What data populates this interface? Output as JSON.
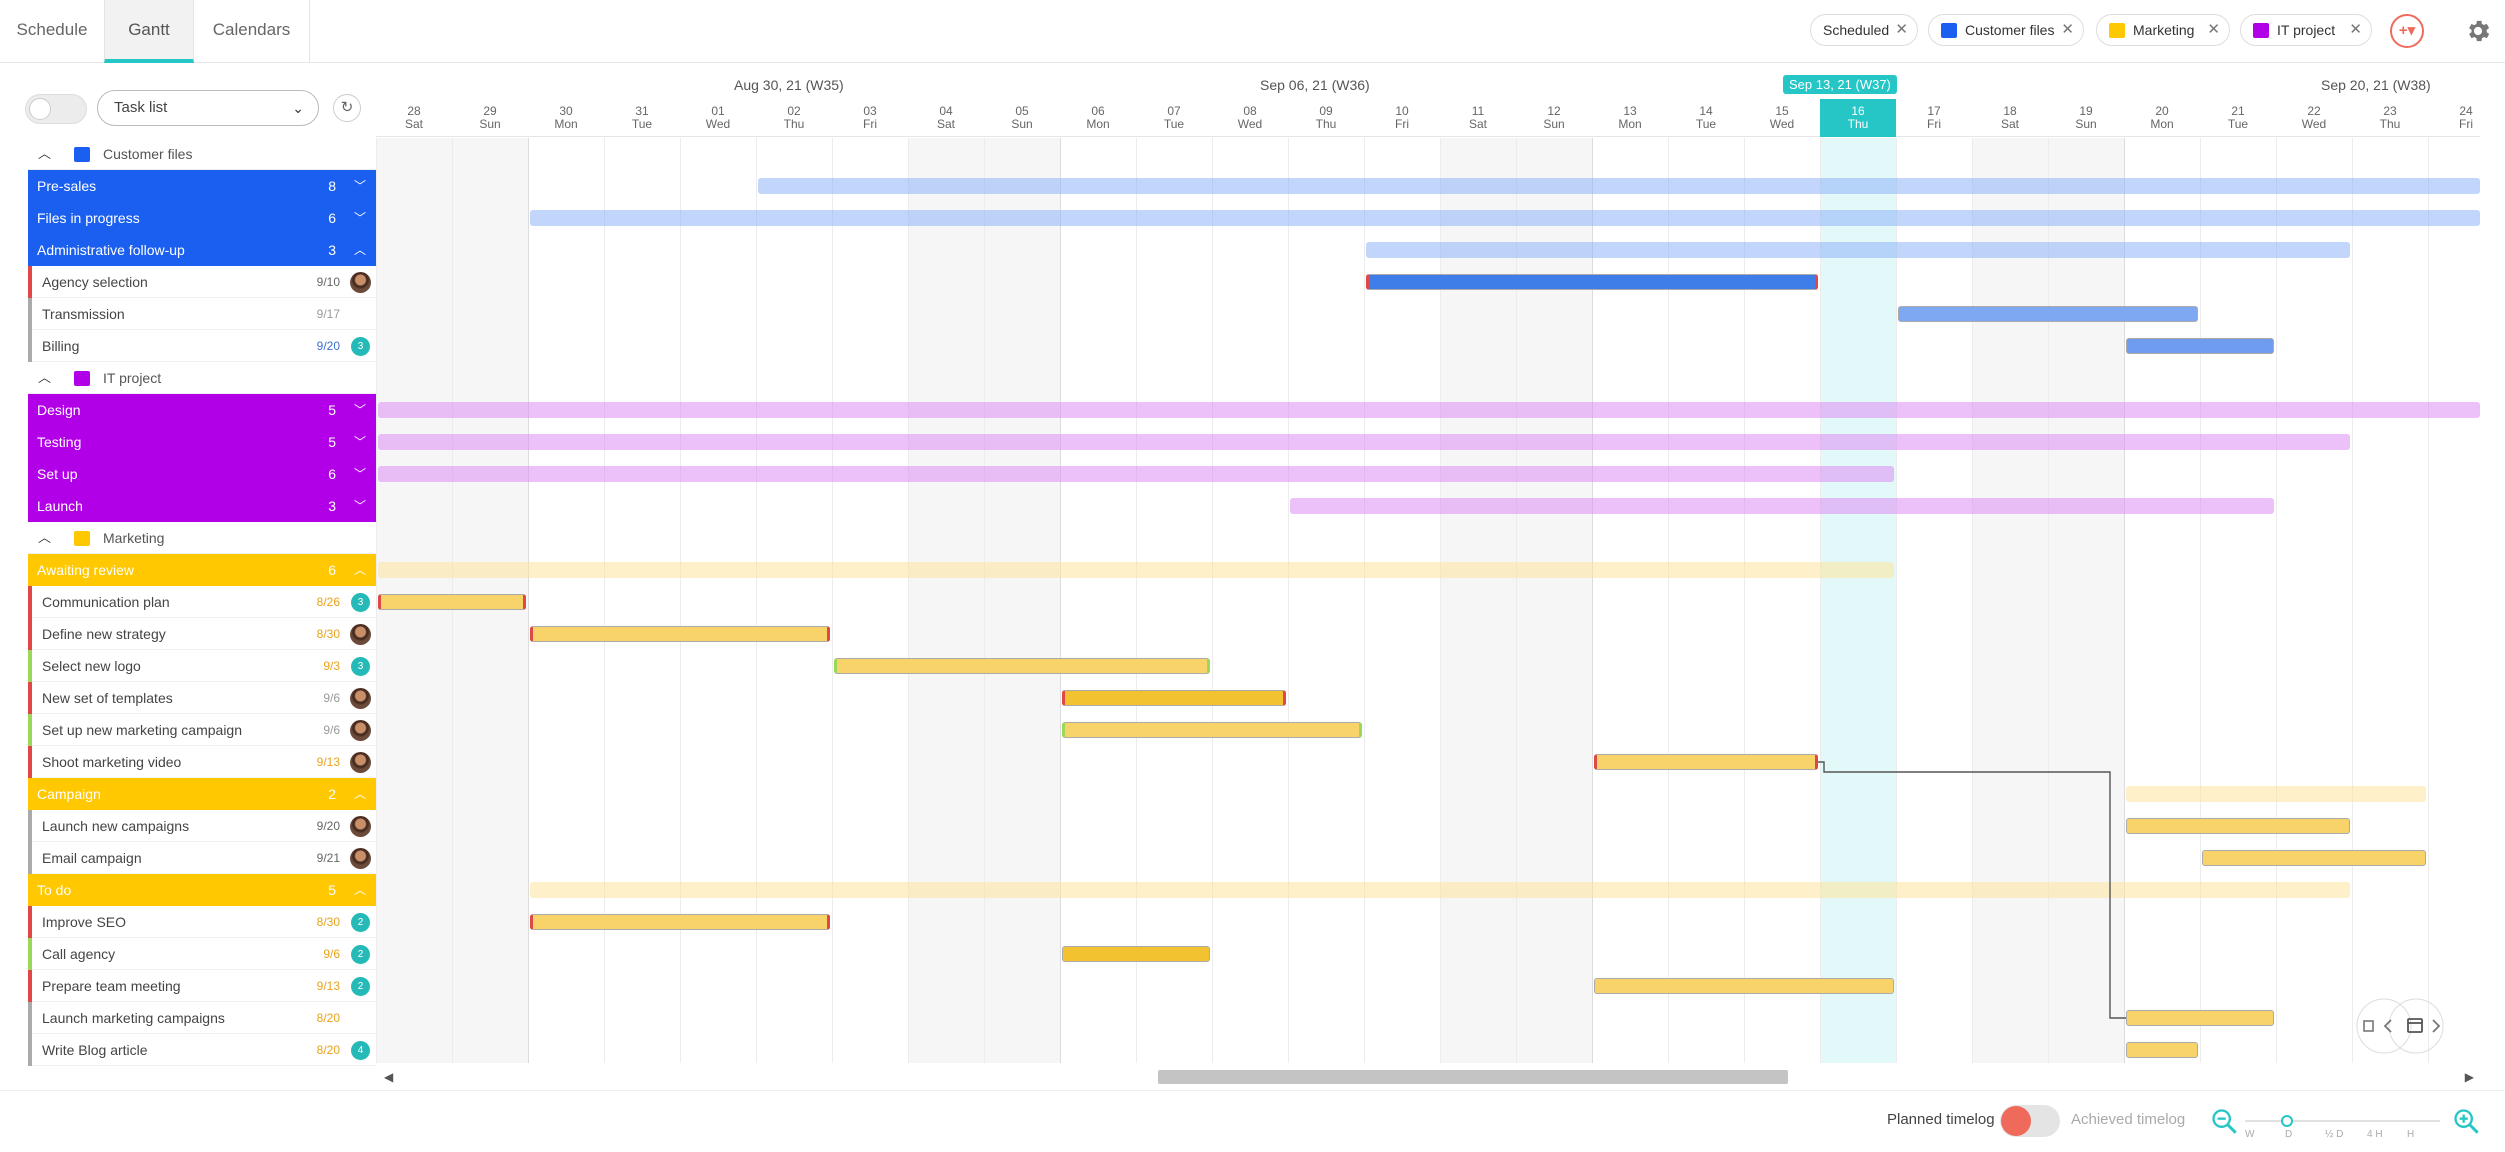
{
  "tabs": [
    {
      "label": "Schedule"
    },
    {
      "label": "Gantt"
    },
    {
      "label": "Calendars"
    }
  ],
  "filters": [
    {
      "label": "Scheduled",
      "color": ""
    },
    {
      "label": "Customer files",
      "color": "#1a5ff0"
    },
    {
      "label": "Marketing",
      "color": "#ffc800"
    },
    {
      "label": "IT project",
      "color": "#b100e8"
    }
  ],
  "filter_button": "+",
  "view_select": {
    "value": "Task list"
  },
  "timeline": {
    "weeks": [
      {
        "label": "Aug 30, 21 (W35)",
        "today": false
      },
      {
        "label": "Sep 06, 21 (W36)",
        "today": false
      },
      {
        "label": "Sep 13, 21 (W37)",
        "today": true
      },
      {
        "label": "Sep 20, 21 (W38)",
        "today": false
      }
    ],
    "days": [
      {
        "n": "28",
        "d": "Sat"
      },
      {
        "n": "29",
        "d": "Sun"
      },
      {
        "n": "30",
        "d": "Mon"
      },
      {
        "n": "31",
        "d": "Tue"
      },
      {
        "n": "01",
        "d": "Wed"
      },
      {
        "n": "02",
        "d": "Thu"
      },
      {
        "n": "03",
        "d": "Fri"
      },
      {
        "n": "04",
        "d": "Sat"
      },
      {
        "n": "05",
        "d": "Sun"
      },
      {
        "n": "06",
        "d": "Mon"
      },
      {
        "n": "07",
        "d": "Tue"
      },
      {
        "n": "08",
        "d": "Wed"
      },
      {
        "n": "09",
        "d": "Thu"
      },
      {
        "n": "10",
        "d": "Fri"
      },
      {
        "n": "11",
        "d": "Sat"
      },
      {
        "n": "12",
        "d": "Sun"
      },
      {
        "n": "13",
        "d": "Mon"
      },
      {
        "n": "14",
        "d": "Tue"
      },
      {
        "n": "15",
        "d": "Wed"
      },
      {
        "n": "16",
        "d": "Thu"
      },
      {
        "n": "17",
        "d": "Fri"
      },
      {
        "n": "18",
        "d": "Sat"
      },
      {
        "n": "19",
        "d": "Sun"
      },
      {
        "n": "20",
        "d": "Mon"
      },
      {
        "n": "21",
        "d": "Tue"
      },
      {
        "n": "22",
        "d": "Wed"
      },
      {
        "n": "23",
        "d": "Thu"
      },
      {
        "n": "24",
        "d": "Fri"
      }
    ]
  },
  "rows": [
    {
      "kind": "cat",
      "label": "Customer files",
      "color": "#1a5ff0",
      "expanded": true
    },
    {
      "kind": "grp",
      "label": "Pre-sales",
      "count": "8",
      "color": "#1a5ff0",
      "open": false,
      "bar": {
        "start": "Sep 02",
        "end": "Sep 24+",
        "color": "#8fb3f7"
      }
    },
    {
      "kind": "grp",
      "label": "Files in progress",
      "count": "6",
      "color": "#1a5ff0",
      "open": false,
      "bar": {
        "start": "Aug 30",
        "end": "Sep 24+",
        "color": "#8fb3f7"
      }
    },
    {
      "kind": "grp",
      "label": "Administrative follow-up",
      "count": "3",
      "color": "#1a5ff0",
      "open": true,
      "bar": {
        "start": "Sep 10",
        "end": "Sep 22",
        "color": "#8fb3f7"
      }
    },
    {
      "kind": "task",
      "label": "Agency selection",
      "date": "9/10",
      "date_color": "#666",
      "stripe": "#e04848",
      "avatar": true,
      "bar": {
        "start": "Sep 10",
        "end": "Sep 15",
        "color": "#3f7de8",
        "edge": "#e04848"
      }
    },
    {
      "kind": "task",
      "label": "Transmission",
      "date": "9/17",
      "date_color": "#999",
      "stripe": "#aaaaaa",
      "bar": {
        "start": "Sep 17",
        "end": "Sep 20",
        "color": "#7fa8f2",
        "edge": ""
      }
    },
    {
      "kind": "task",
      "label": "Billing",
      "date": "9/20",
      "date_color": "#3e6fd4",
      "stripe": "#aaaaaa",
      "badge": "3",
      "bar": {
        "start": "Sep 20",
        "end": "Sep 21",
        "color": "#6f9cee",
        "edge": ""
      }
    },
    {
      "kind": "cat",
      "label": "IT project",
      "color": "#b100e8",
      "expanded": true
    },
    {
      "kind": "grp",
      "label": "Design",
      "count": "5",
      "color": "#b100e8",
      "open": false,
      "bar": {
        "start": "Aug 28",
        "end": "Sep 24+",
        "color": "#dd8cf2"
      }
    },
    {
      "kind": "grp",
      "label": "Testing",
      "count": "5",
      "color": "#b100e8",
      "open": false,
      "bar": {
        "start": "Aug 28",
        "end": "Sep 22",
        "color": "#dd8cf2"
      }
    },
    {
      "kind": "grp",
      "label": "Set up",
      "count": "6",
      "color": "#b100e8",
      "open": false,
      "bar": {
        "start": "Aug 28",
        "end": "Sep 16",
        "color": "#dd8cf2"
      }
    },
    {
      "kind": "grp",
      "label": "Launch",
      "count": "3",
      "color": "#b100e8",
      "open": false,
      "bar": {
        "start": "Sep 09",
        "end": "Sep 21",
        "color": "#dd8cf2"
      }
    },
    {
      "kind": "cat",
      "label": "Marketing",
      "color": "#ffc800",
      "expanded": true
    },
    {
      "kind": "grp",
      "label": "Awaiting review",
      "count": "6",
      "color": "#ffc800",
      "open": true,
      "bar": {
        "start": "Aug 28",
        "end": "Sep 16",
        "color": "#fde49a"
      }
    },
    {
      "kind": "task",
      "label": "Communication plan",
      "date": "8/26",
      "date_color": "#e8a21a",
      "stripe": "#e04848",
      "badge": "3",
      "bar": {
        "start": "Aug 28",
        "end": "Aug 29",
        "color": "#f7d36a",
        "edge": "#e04848"
      }
    },
    {
      "kind": "task",
      "label": "Define new strategy",
      "date": "8/30",
      "date_color": "#e8a21a",
      "stripe": "#e04848",
      "avatar": true,
      "bar": {
        "start": "Aug 30",
        "end": "Sep 02",
        "color": "#f7d36a",
        "edge": "#e04848"
      }
    },
    {
      "kind": "task",
      "label": "Select new logo",
      "date": "9/3",
      "date_color": "#e8a21a",
      "stripe": "#9ad85a",
      "badge": "3",
      "bar": {
        "start": "Sep 03",
        "end": "Sep 07",
        "color": "#f7d36a",
        "edge": "#9ad85a"
      }
    },
    {
      "kind": "task",
      "label": "New set of templates",
      "date": "9/6",
      "date_color": "#999",
      "stripe": "#e04848",
      "avatar": true,
      "bar": {
        "start": "Sep 06",
        "end": "Sep 08",
        "color": "#f2c230",
        "edge": "#e04848"
      }
    },
    {
      "kind": "task",
      "label": "Set up new marketing campaign",
      "date": "9/6",
      "date_color": "#999",
      "stripe": "#9ad85a",
      "avatar": true,
      "bar": {
        "start": "Sep 06",
        "end": "Sep 09",
        "color": "#f7d36a",
        "edge": "#9ad85a"
      }
    },
    {
      "kind": "task",
      "label": "Shoot marketing video",
      "date": "9/13",
      "date_color": "#e8a21a",
      "stripe": "#e04848",
      "avatar": true,
      "bar": {
        "start": "Sep 13",
        "end": "Sep 15",
        "color": "#f7d36a",
        "edge": "#e04848"
      }
    },
    {
      "kind": "grp",
      "label": "Campaign",
      "count": "2",
      "color": "#ffc800",
      "open": true,
      "bar": {
        "start": "Sep 20",
        "end": "Sep 23",
        "color": "#fde49a"
      }
    },
    {
      "kind": "task",
      "label": "Launch new campaigns",
      "date": "9/20",
      "date_color": "#666",
      "stripe": "#aaaaaa",
      "avatar": true,
      "bar": {
        "start": "Sep 20",
        "end": "Sep 22",
        "color": "#f7d36a",
        "edge": ""
      }
    },
    {
      "kind": "task",
      "label": "Email campaign",
      "date": "9/21",
      "date_color": "#666",
      "stripe": "#aaaaaa",
      "avatar": true,
      "bar": {
        "start": "Sep 21",
        "end": "Sep 23",
        "color": "#f7d36a",
        "edge": ""
      }
    },
    {
      "kind": "grp",
      "label": "To do",
      "count": "5",
      "color": "#ffc800",
      "open": true,
      "bar": {
        "start": "Aug 30",
        "end": "Sep 22",
        "color": "#fde49a"
      }
    },
    {
      "kind": "task",
      "label": "Improve SEO",
      "date": "8/30",
      "date_color": "#e8a21a",
      "stripe": "#e04848",
      "badge": "2",
      "bar": {
        "start": "Aug 30",
        "end": "Sep 02",
        "color": "#f7d36a",
        "edge": "#e04848"
      }
    },
    {
      "kind": "task",
      "label": "Call agency",
      "date": "9/6",
      "date_color": "#e8a21a",
      "stripe": "#9ad85a",
      "badge": "2",
      "bar": {
        "start": "Sep 06",
        "end": "Sep 07",
        "color": "#f2c230",
        "edge": ""
      }
    },
    {
      "kind": "task",
      "label": "Prepare team meeting",
      "date": "9/13",
      "date_color": "#e8a21a",
      "stripe": "#e04848",
      "badge": "2",
      "bar": {
        "start": "Sep 13",
        "end": "Sep 16",
        "color": "#f7d36a",
        "edge": ""
      }
    },
    {
      "kind": "task",
      "label": "Launch marketing campaigns",
      "date": "8/20",
      "date_color": "#e8a21a",
      "stripe": "#aaaaaa",
      "bar": {
        "start": "Sep 20",
        "end": "Sep 21",
        "color": "#f7d36a",
        "edge": ""
      }
    },
    {
      "kind": "task",
      "label": "Write Blog article",
      "date": "8/20",
      "date_color": "#e8a21a",
      "stripe": "#aaaaaa",
      "badge": "4",
      "bar": {
        "start": "Sep 20",
        "end": "Sep 20",
        "color": "#f7d36a",
        "edge": ""
      }
    }
  ],
  "footer": {
    "planned_label": "Planned timelog",
    "achieved_label": "Achieved timelog",
    "zoom_levels": [
      "W",
      "D",
      "½ D",
      "4 H",
      "H"
    ]
  },
  "colors": {
    "accent": "#26c6c6",
    "danger": "#ee6b5d"
  }
}
